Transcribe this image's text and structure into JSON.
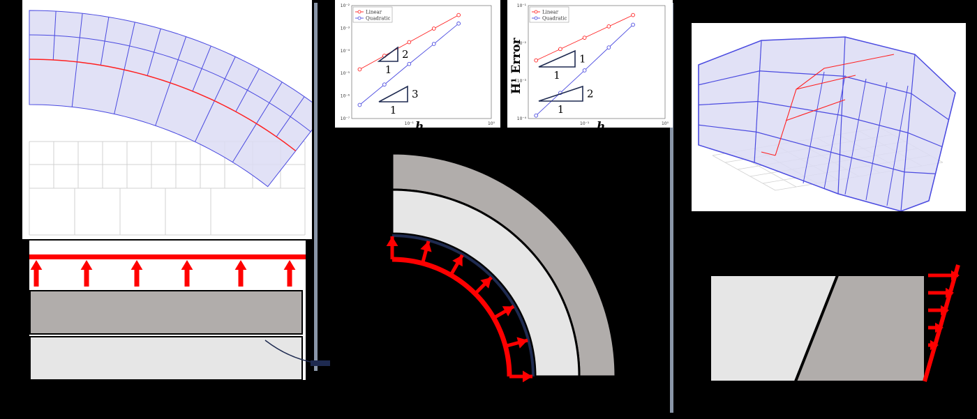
{
  "colors": {
    "mesh_line": "#4a4ae0",
    "mesh_fill": "#dcdcf5",
    "interface": "#ff2020",
    "load": "#ff0000",
    "layer_dark": "#b1adab",
    "layer_light": "#e6e6e6",
    "ref_grid": "#d0d0d0"
  },
  "convergence_plots": [
    {
      "ylabel_visible": "",
      "xlabel_visible": "h",
      "legend": [
        "Linear",
        "Quadratic"
      ],
      "x_ticks": [
        "10⁻¹",
        "10⁰"
      ],
      "y_ticks": [
        "10⁻²",
        "10⁻³",
        "10⁻⁴",
        "10⁻⁵",
        "10⁻⁶",
        "10⁻⁷"
      ],
      "slope_triangles": [
        {
          "rise": "2",
          "run": "1"
        },
        {
          "rise": "3",
          "run": "1"
        }
      ]
    },
    {
      "ylabel_visible": "H¹ Error",
      "xlabel_visible": "h",
      "legend": [
        "Linear",
        "Quadratic"
      ],
      "x_ticks": [
        "10⁻¹",
        "10⁰"
      ],
      "y_ticks": [
        "10⁻¹",
        "10⁻²",
        "10⁻³",
        "10⁻⁴"
      ],
      "slope_triangles": [
        {
          "rise": "1",
          "run": "1"
        },
        {
          "rise": "2",
          "run": "1"
        }
      ]
    }
  ],
  "chart_data": [
    {
      "type": "line",
      "title": "",
      "xlabel": "h",
      "ylabel": "",
      "log_x": true,
      "log_y": true,
      "legend_position": "top-left",
      "grid": false,
      "series": [
        {
          "name": "Linear",
          "x": [
            0.025,
            0.05,
            0.1,
            0.2,
            0.4
          ],
          "y": [
            1.5e-05,
            6e-05,
            0.00024,
            0.00096,
            0.0038
          ]
        },
        {
          "name": "Quadratic",
          "x": [
            0.025,
            0.05,
            0.1,
            0.2,
            0.4
          ],
          "y": [
            4e-07,
            3.2e-06,
            2.6e-05,
            0.0002,
            0.0016
          ]
        }
      ]
    },
    {
      "type": "line",
      "title": "",
      "xlabel": "h",
      "ylabel": "H¹ Error",
      "log_x": true,
      "log_y": true,
      "legend_position": "top-left",
      "grid": false,
      "series": [
        {
          "name": "Linear",
          "x": [
            0.025,
            0.05,
            0.1,
            0.2,
            0.4
          ],
          "y": [
            0.0035,
            0.007,
            0.014,
            0.028,
            0.056
          ]
        },
        {
          "name": "Quadratic",
          "x": [
            0.025,
            0.05,
            0.1,
            0.2,
            0.4
          ],
          "y": [
            0.00012,
            0.00048,
            0.0019,
            0.0077,
            0.031
          ]
        }
      ]
    }
  ]
}
